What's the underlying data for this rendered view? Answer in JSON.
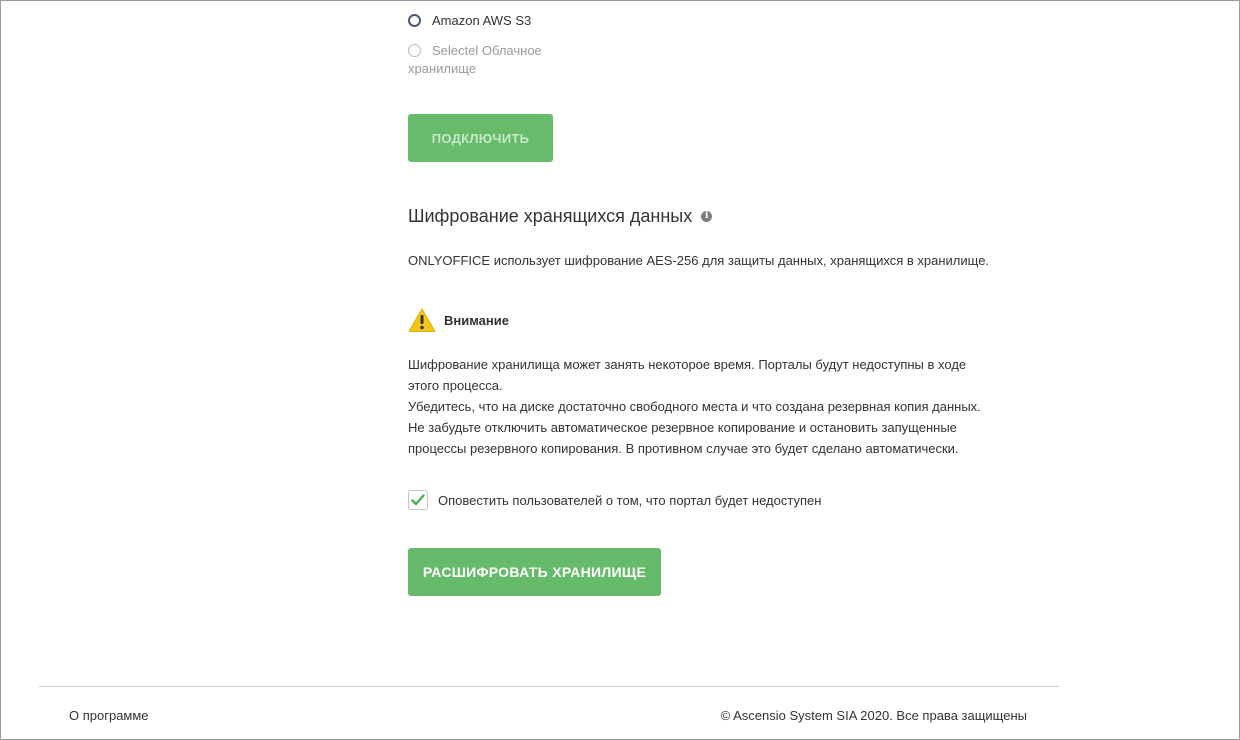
{
  "storage_options": {
    "aws": {
      "label": "Amazon AWS S3"
    },
    "selectel": {
      "label_line1": "Selectel Облачное",
      "label_line2": "хранилище"
    }
  },
  "connect_button": {
    "label": "ПОДКЛЮЧИТЬ"
  },
  "encryption": {
    "title": "Шифрование хранящихся данных",
    "description": "ONLYOFFICE использует шифрование AES-256 для защиты данных, хранящихся в хранилище.",
    "warning_title": "Внимание",
    "warning_lines": [
      "Шифрование хранилища может занять некоторое время. Порталы будут недоступны в ходе",
      "этого процесса.",
      "Убедитесь, что на диске достаточно свободного места и что создана резервная копия данных.",
      "Не забудьте отключить автоматическое резервное копирование и остановить запущенные",
      "процессы резервного копирования. В противном случае это будет сделано автоматически."
    ],
    "notify_checkbox": {
      "label": "Оповестить пользователей о том, что портал будет недоступен",
      "checked": true
    },
    "decrypt_button": {
      "label": "РАСШИФРОВАТЬ ХРАНИЛИЩЕ"
    }
  },
  "footer": {
    "about": "О программе",
    "copyright": "© Ascensio System SIA 2020. Все права защищены"
  },
  "colors": {
    "button_green": "#66bb6a",
    "checkmark_green": "#4caf50",
    "warning_yellow": "#f5c518"
  }
}
